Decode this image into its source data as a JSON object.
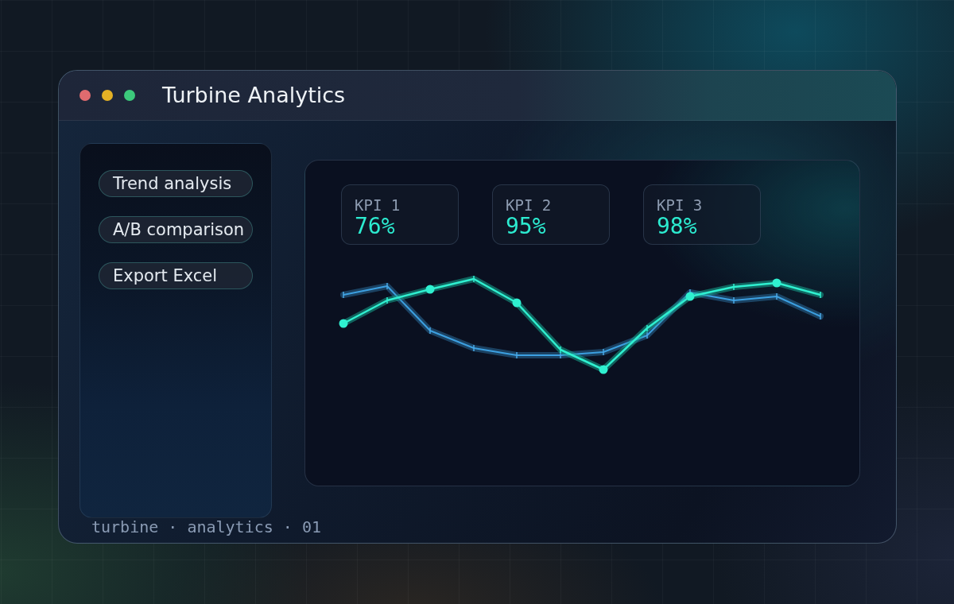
{
  "window": {
    "title": "Turbine Analytics"
  },
  "sidebar": {
    "items": [
      {
        "label": "Trend analysis"
      },
      {
        "label": "A/B comparison"
      },
      {
        "label": "Export Excel"
      }
    ]
  },
  "kpis": [
    {
      "label": "KPI 1",
      "value": "76%"
    },
    {
      "label": "KPI 2",
      "value": "95%"
    },
    {
      "label": "KPI 3",
      "value": "98%"
    }
  ],
  "footer": "turbine · analytics · 01"
}
